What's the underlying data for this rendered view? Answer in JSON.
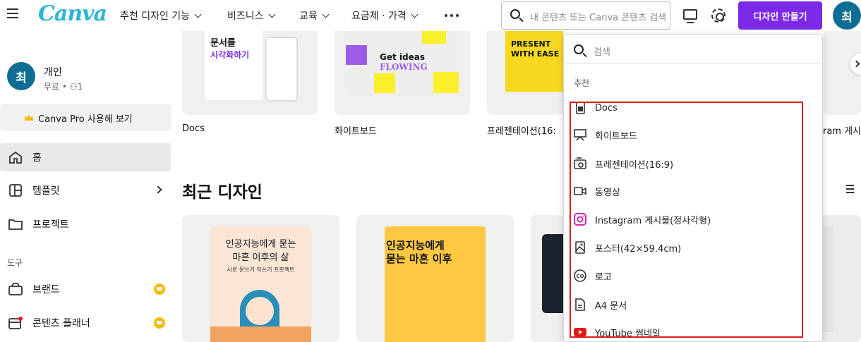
{
  "header": {
    "logo": "Canva",
    "nav": [
      "추천 디자인 기능",
      "비즈니스",
      "교육",
      "요금제 · 가격"
    ],
    "search_placeholder": "내 콘텐츠 또는 Canva 콘텐츠 검색",
    "create_button": "디자인 만들기",
    "avatar_initial": "최"
  },
  "account": {
    "avatar_initial": "최",
    "name": "개인",
    "plan": "무료 • ",
    "members": "1"
  },
  "sidebar": {
    "pro_button": "Canva Pro 사용해 보기",
    "items": [
      {
        "label": "홈"
      },
      {
        "label": "템플릿"
      },
      {
        "label": "프로젝트"
      }
    ],
    "tools_label": "도구",
    "tools": [
      {
        "label": "브랜드"
      },
      {
        "label": "콘텐츠 플래너"
      }
    ]
  },
  "top_cards": [
    {
      "caption": "Docs",
      "thumb_title": "문서를",
      "thumb_title2": "시각화하기"
    },
    {
      "caption": "화이트보드",
      "thumb_text": "Get ideas",
      "thumb_text2": "FLOWING"
    },
    {
      "caption": "프레젠테이션(16:",
      "thumb_text": "PRESENT",
      "thumb_text2": "WITH EASE"
    },
    {
      "caption": "ram 게시"
    }
  ],
  "recent": {
    "title": "최근 디자인",
    "cards": [
      {
        "line1": "인공지능에게 묻는",
        "line2": "마흔 이후의 삶",
        "line3": "시로 문쓰기 작쓰기 프로젝트"
      },
      {
        "line1": "인공지능에게",
        "line2": "묻는 마흔 이후"
      }
    ]
  },
  "dropdown": {
    "search_placeholder": "검색",
    "section_label": "추천",
    "items": [
      {
        "label": "Docs",
        "icon": "doc-icon"
      },
      {
        "label": "화이트보드",
        "icon": "whiteboard-icon"
      },
      {
        "label": "프레젠테이션(16:9)",
        "icon": "presentation-icon"
      },
      {
        "label": "동영상",
        "icon": "video-icon"
      },
      {
        "label": "Instagram 게시물(정사각형)",
        "icon": "instagram-icon"
      },
      {
        "label": "포스터(42×59.4cm)",
        "icon": "poster-icon"
      },
      {
        "label": "로고",
        "icon": "logo-icon"
      },
      {
        "label": "A4 문서",
        "icon": "document-icon"
      },
      {
        "label": "YouTube 썸네일",
        "icon": "youtube-icon"
      }
    ]
  },
  "colors": {
    "accent_purple": "#7d2ae8",
    "avatar_blue": "#0f6d93",
    "logo_teal": "#2fb4d8",
    "highlight_red": "#e01b1b"
  }
}
